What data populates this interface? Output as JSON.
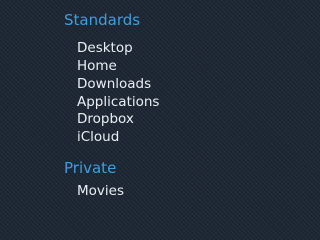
{
  "colors": {
    "background": "#1d2734",
    "section_header": "#3b9fe0",
    "item_text": "#e8eef4"
  },
  "sidebar": {
    "sections": [
      {
        "label": "Standards",
        "items": [
          "Desktop",
          "Home",
          "Downloads",
          "Applications",
          "Dropbox",
          "iCloud"
        ]
      },
      {
        "label": "Private",
        "items": [
          "Movies"
        ]
      }
    ]
  }
}
